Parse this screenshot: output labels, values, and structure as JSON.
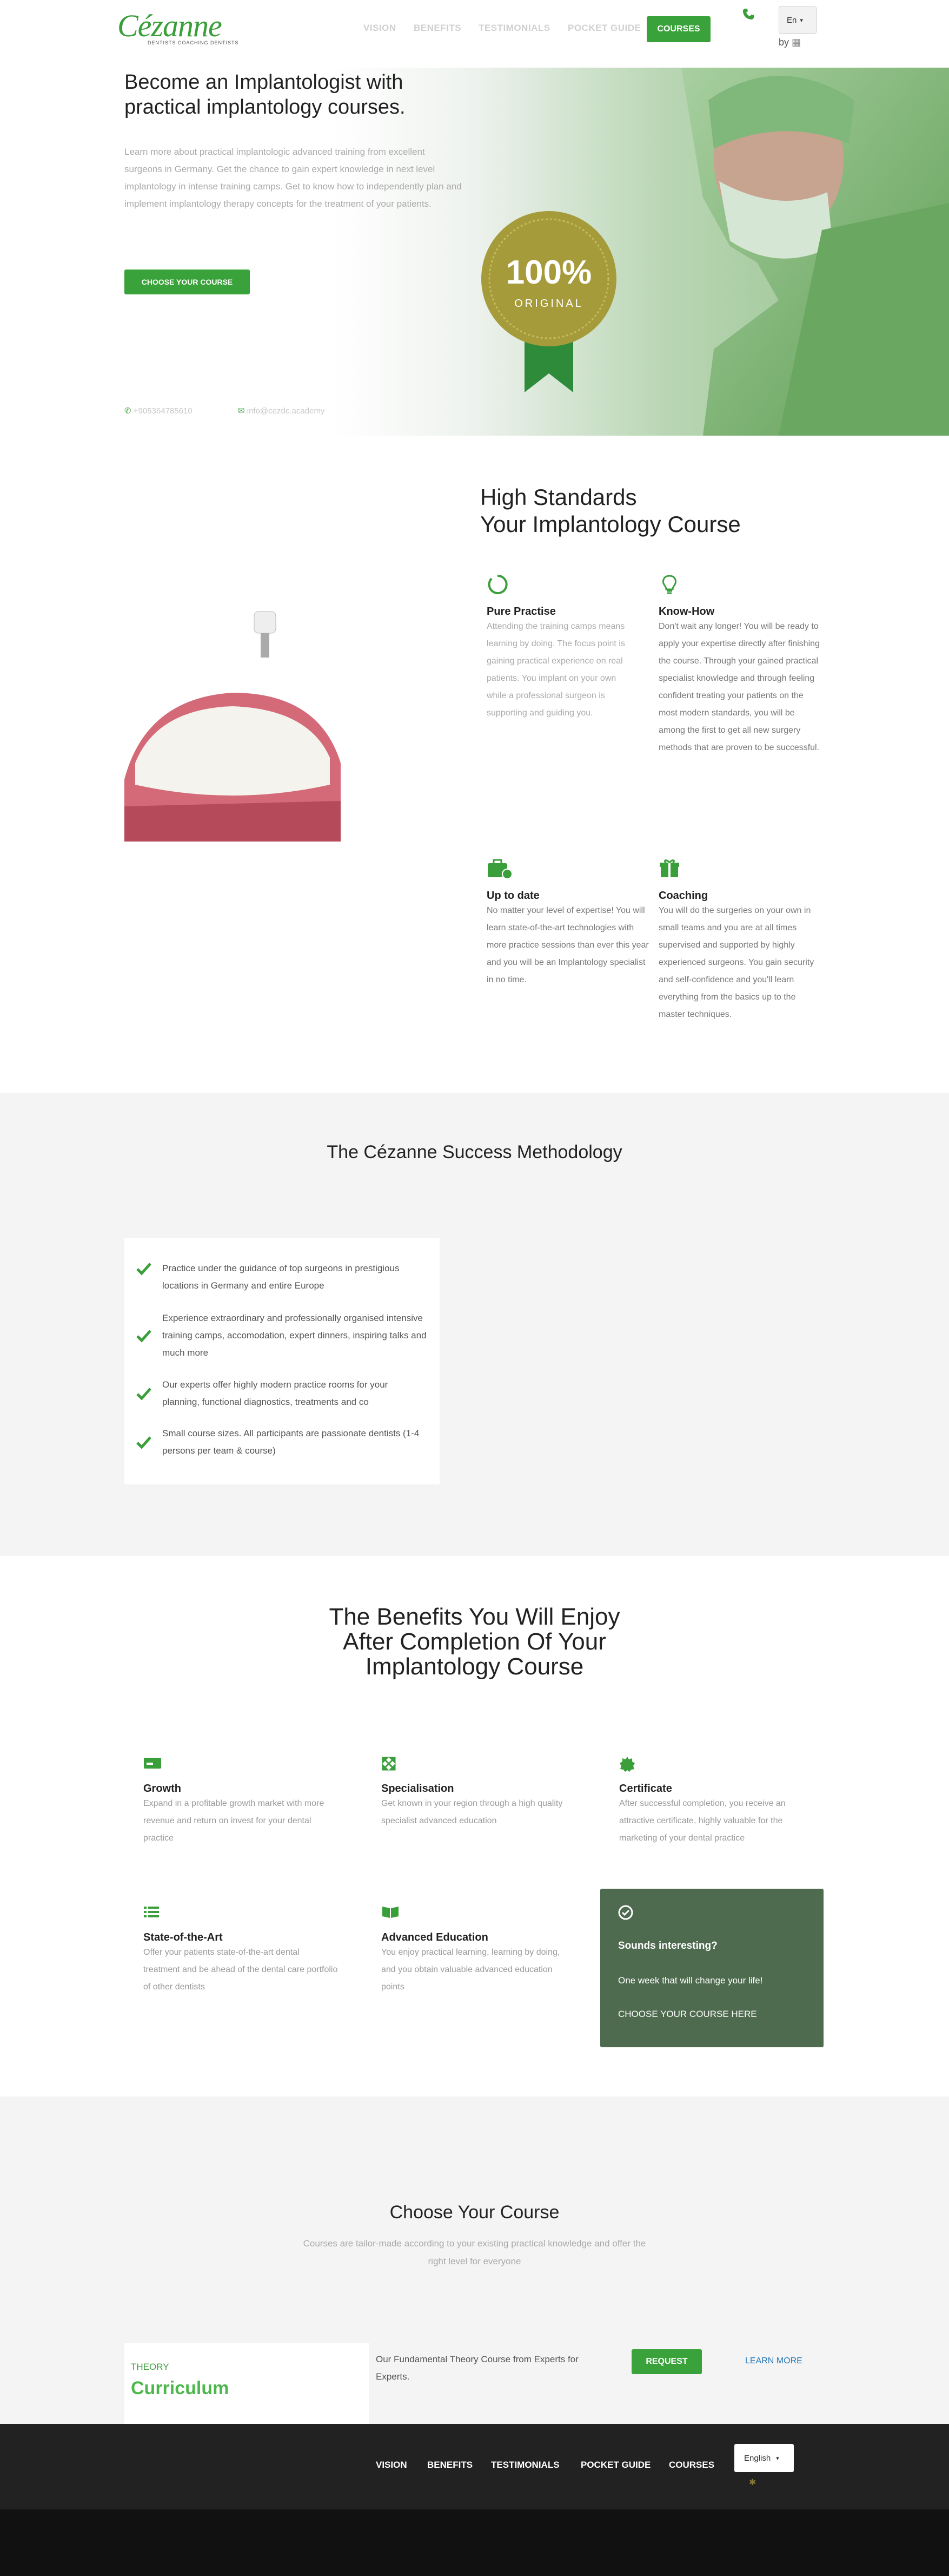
{
  "header": {
    "logo_text": "Cézanne",
    "logo_sub": "DENTISTS COACHING DENTISTS",
    "nav": [
      "VISION",
      "BENEFITS",
      "TESTIMONIALS",
      "POCKET GUIDE"
    ],
    "courses_button": "COURSES",
    "language": "En",
    "byline": "by"
  },
  "hero": {
    "title": "Become an Implantologist with practical implantology courses.",
    "text": "Learn more about practical implantologic advanced training from excellent surgeons in Germany. Get the chance to gain expert knowledge in next level implantology in intense training camps. Get to know how to independently plan and implement implantology therapy concepts for the treatment of your patients.",
    "cta": "CHOOSE YOUR COURSE",
    "phone": "+905364785610",
    "email": "info@cezdc.academy",
    "badge_value": "100%",
    "badge_label": "ORIGINAL"
  },
  "standards": {
    "title_line1": "High Standards",
    "title_line2": "Your Implantology Course",
    "features": [
      {
        "icon": "circle-notch-icon",
        "title": "Pure Practise",
        "text": "Attending the training camps means learning by doing. The focus point is gaining practical experience on real patients. You implant on your own while a professional surgeon is supporting and guiding you."
      },
      {
        "icon": "lightbulb-icon",
        "title": "Know-How",
        "text": "Don't wait any longer! You will be ready to apply your expertise directly after finishing the course. Through your gained practical specialist knowledge and through feeling confident treating your patients on the most modern standards, you will be among the first to get all new surgery methods that are proven to be successful."
      },
      {
        "icon": "briefcase-clock-icon",
        "title": "Up to date",
        "text": "No matter your level of expertise! You will learn state-of-the-art technologies with more practice sessions than ever this year and you will be an Implantology specialist in no time."
      },
      {
        "icon": "gift-icon",
        "title": "Coaching",
        "text": "You will do the surgeries on your own in small teams and you are at all times supervised and supported by highly experienced surgeons. You gain security and self-confidence and you'll learn everything from the basics up to the master techniques."
      }
    ]
  },
  "methodology": {
    "title": "The Cézanne Success Methodology",
    "items": [
      "Practice under the guidance of top surgeons in prestigious locations in Germany and entire Europe",
      "Experience extraordinary and professionally organised intensive training camps, accomodation, expert dinners, inspiring talks and much more",
      "Our experts offer highly modern practice rooms for your planning, functional diagnostics, treatments and co",
      "Small course sizes. All participants are passionate dentists (1-4 persons per team & course)"
    ]
  },
  "benefits": {
    "title_line1": "The Benefits You Will Enjoy",
    "title_line2": "After Completion Of Your",
    "title_line3": "Implantology Course",
    "items": [
      {
        "icon": "money-card-icon",
        "title": "Growth",
        "text": "Expand in a profitable growth market with more revenue and return on invest for your dental practice"
      },
      {
        "icon": "expand-arrows-icon",
        "title": "Specialisation",
        "text": "Get known in your region through a high quality specialist advanced education"
      },
      {
        "icon": "certificate-icon",
        "title": "Certificate",
        "text": "After successful completion, you receive an attractive certificate, highly valuable for the marketing of your dental practice"
      },
      {
        "icon": "list-icon",
        "title": "State-of-the-Art",
        "text": "Offer your patients state-of-the-art dental treatment and be ahead of the dental care portfolio of other dentists"
      },
      {
        "icon": "open-book-icon",
        "title": "Advanced Education",
        "text": "You enjoy practical learning, learning by doing, and you obtain valuable advanced education points"
      }
    ],
    "interest": {
      "title": "Sounds interesting?",
      "text": "One week that will change your life!",
      "link": "CHOOSE YOUR COURSE HERE"
    }
  },
  "choose": {
    "title": "Choose Your Course",
    "text": "Courses are tailor-made according to your existing practical knowledge and offer the right level for everyone",
    "course": {
      "kicker": "THEORY",
      "name": "Curriculum",
      "desc": "Our Fundamental Theory Course from Experts for Experts.",
      "request": "REQUEST",
      "learn_more": "LEARN MORE"
    }
  },
  "footer": {
    "nav": [
      "VISION",
      "BENEFITS",
      "TESTIMONIALS",
      "POCKET GUIDE",
      "COURSES"
    ],
    "language": "English"
  },
  "colors": {
    "accent": "#3aa23a",
    "interest_bg": "#4f6b4f",
    "footer_bg": "#222222"
  }
}
